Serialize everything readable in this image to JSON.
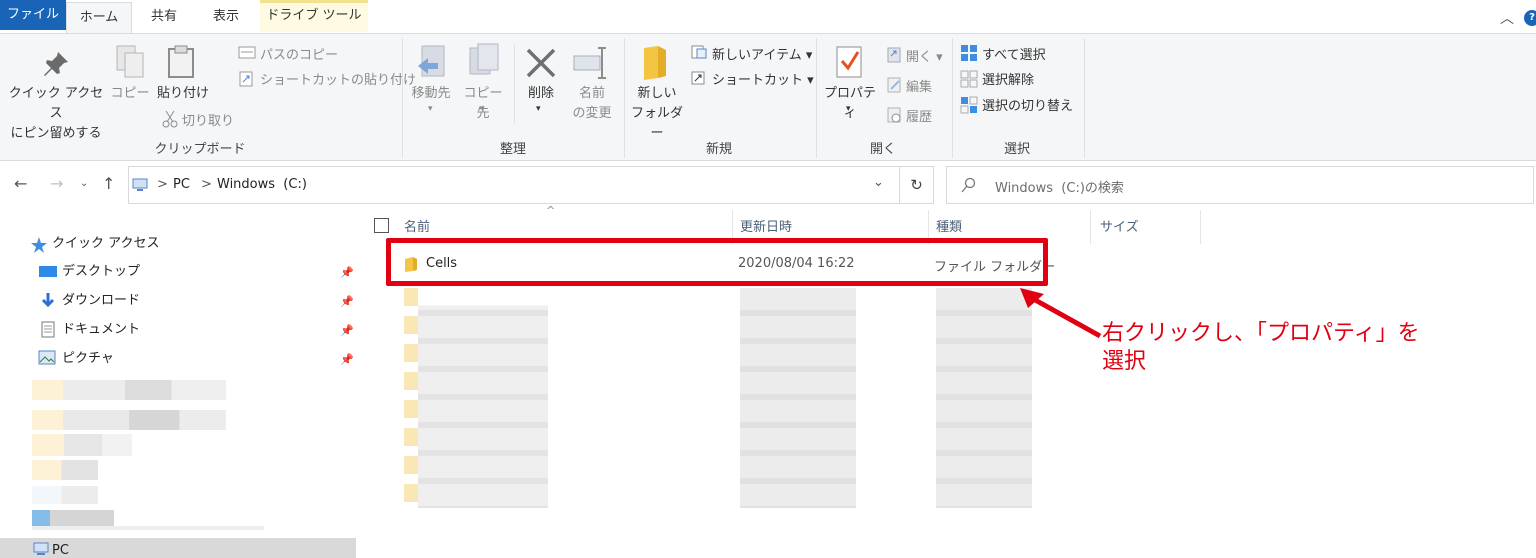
{
  "ribbon_tabs": {
    "file": "ファイル",
    "home": "ホーム",
    "share": "共有",
    "view": "表示",
    "drive_tools": "ドライブ ツール"
  },
  "ribbon": {
    "clipboard": {
      "pin_quick_line1": "クイック アクセス",
      "pin_quick_line2": "にピン留めする",
      "copy": "コピー",
      "paste": "貼り付け",
      "copy_path": "パスのコピー",
      "paste_shortcut": "ショートカットの貼り付け",
      "cut": "切り取り",
      "label": "クリップボード"
    },
    "organize": {
      "move_to": "移動先",
      "copy_to": "コピー先",
      "delete": "削除",
      "rename_line1": "名前",
      "rename_line2": "の変更",
      "label": "整理"
    },
    "new": {
      "new_folder_line1": "新しい",
      "new_folder_line2": "フォルダー",
      "new_item": "新しいアイテム",
      "shortcut": "ショートカット",
      "label": "新規"
    },
    "open": {
      "properties": "プロパティ",
      "open": "開く",
      "edit": "編集",
      "history": "履歴",
      "label": "開く"
    },
    "select": {
      "select_all": "すべて選択",
      "select_none": "選択解除",
      "invert": "選択の切り替え",
      "label": "選択"
    }
  },
  "address": {
    "crumb_pc": "PC",
    "crumb_drive": "Windows  (C:)",
    "search_placeholder": "Windows  (C:)の検索"
  },
  "nav_pane": {
    "quick_access": "クイック アクセス",
    "items": [
      "デスクトップ",
      "ダウンロード",
      "ドキュメント",
      "ピクチャ"
    ],
    "pc": "PC"
  },
  "columns": {
    "name": "名前",
    "modified": "更新日時",
    "type": "種類",
    "size": "サイズ"
  },
  "rows": [
    {
      "name": "Cells",
      "modified": "2020/08/04 16:22",
      "type": "ファイル フォルダー"
    }
  ],
  "annotation": {
    "line1": "右クリックし、「プロパティ」を",
    "line2": "選択"
  },
  "colors": {
    "accent": "#1a64b8",
    "highlight": "#e00012",
    "folder": "#f4c542"
  }
}
